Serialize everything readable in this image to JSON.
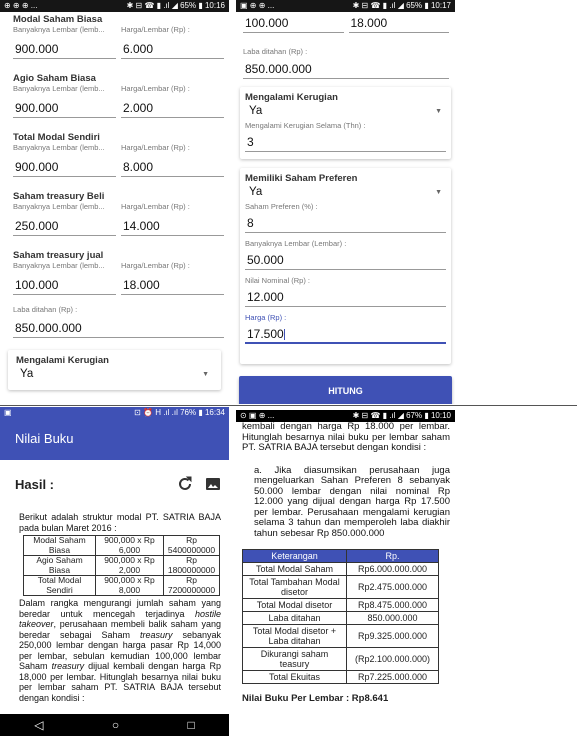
{
  "p1": {
    "status": {
      "left": "⊕ ⊕ ⊕ ...",
      "right": "✱ ⊟ ☎ ▮ .ıl ◢ 65% ▮ 10:16"
    },
    "groups": [
      {
        "title": "Modal Saham Biasa",
        "cap1": "Banyaknya Lembar (lemb...",
        "cap2": "Harga/Lembar (Rp) :",
        "v1": "900.000",
        "v2": "6.000"
      },
      {
        "title": "Agio Saham Biasa",
        "cap1": "Banyaknya Lembar (lemb...",
        "cap2": "Harga/Lembar (Rp) :",
        "v1": "900.000",
        "v2": "2.000"
      },
      {
        "title": "Total Modal Sendiri",
        "cap1": "Banyaknya Lembar (lemb...",
        "cap2": "Harga/Lembar (Rp) :",
        "v1": "900.000",
        "v2": "8.000"
      },
      {
        "title": "Saham treasury Beli",
        "cap1": "Banyaknya Lembar (lemb...",
        "cap2": "Harga/Lembar (Rp) :",
        "v1": "250.000",
        "v2": "14.000"
      },
      {
        "title": "Saham treasury jual",
        "cap1": "Banyaknya Lembar (lemb...",
        "cap2": "Harga/Lembar (Rp) :",
        "v1": "100.000",
        "v2": "18.000"
      }
    ],
    "laba_label": "Laba ditahan (Rp) :",
    "laba_value": "850.000.000",
    "kerugian_title": "Mengalami Kerugian",
    "kerugian_value": "Ya"
  },
  "p2": {
    "status": {
      "left": "▣ ⊕ ⊕ ...",
      "right": "✱ ⊟ ☎ ▮ .ıl ◢ 65% ▮ 10:17"
    },
    "top_v1": "100.000",
    "top_v2": "18.000",
    "laba_label": "Laba ditahan (Rp) :",
    "laba_value": "850.000.000",
    "kerugian_title": "Mengalami Kerugian",
    "kerugian_value": "Ya",
    "kerugian_thn_label": "Mengalami Kerugian Selama (Thn) :",
    "kerugian_thn_value": "3",
    "preferen_title": "Memiliki Saham Preferen",
    "preferen_value": "Ya",
    "pref_pct_label": "Saham Preferen (%) :",
    "pref_pct_value": "8",
    "lembar_label": "Banyaknya Lembar (Lembar) :",
    "lembar_value": "50.000",
    "nominal_label": "Nilai Nominal (Rp) :",
    "nominal_value": "12.000",
    "harga_label": "Harga (Rp) :",
    "harga_value": "17.500",
    "button": "HITUNG"
  },
  "p3": {
    "status": {
      "left": "▣",
      "right": "⊡ ⏰ H .ıl .ıl 76% ▮ 16:34"
    },
    "appbar_title": "Nilai Buku",
    "hasil": "Hasil :",
    "intro": "Berikut adalah struktur modal PT. SATRIA BAJA pada bulan Maret 2016 :",
    "table": [
      [
        "Modal Saham Biasa",
        "900,000 x Rp 6,000",
        "Rp 5400000000"
      ],
      [
        "Agio Saham Biasa",
        "900,000 x Rp 2,000",
        "Rp 1800000000"
      ],
      [
        "Total Modal Sendiri",
        "900,000 x Rp 8,000",
        "Rp 7200000000"
      ]
    ],
    "para_a": "Dalam rangka mengurangi jumlah saham yang beredar untuk mencegah terjadinya ",
    "para_b": "hostile takeover",
    "para_c": ", perusahaan membeli balik saham yang beredar sebagai Saham ",
    "para_d": "treasury",
    "para_e": " sebanyak 250,000 lembar dengan harga pasar Rp 14,000 per lembar, sebulan kemudian 100,000 lembar Saham ",
    "para_f": "treasury",
    "para_g": " dijual kembali dengan harga Rp 18,000 per lembar. Hitunglah besarnya nilai buku per lembar saham PT. SATRIA BAJA tersebut dengan kondisi :",
    "nav": {
      "back": "◁",
      "home": "○",
      "recent": "□"
    }
  },
  "p4": {
    "status": {
      "left": "⊙ ▣ ⊕ ...",
      "right": "✱ ⊟ ☎ ▮ .ıl ◢ 67% ▮ 10:10"
    },
    "top_text": "kembali dengan harga Rp 18.000 per lembar. Hitunglah besarnya nilai buku per lembar saham PT. SATRIA BAJA tersebut dengan kondisi :",
    "item_a": "a. Jika diasumsikan perusahaan juga mengeluarkan Sahan Preferen 8 sebanyak 50.000 lembar dengan nilai nominal Rp 12.000 yang dijual dengan harga Rp 17.500 per lembar. Perusahaan mengalami kerugian selama 3 tahun dan memperoleh laba diakhir tahun sebesar Rp 850.000.000",
    "headers": [
      "Keterangan",
      "Rp."
    ],
    "rows": [
      [
        "Total Modal Saham",
        "Rp6.000.000.000"
      ],
      [
        "Total Tambahan Modal disetor",
        "Rp2.475.000.000"
      ],
      [
        "Total Modal disetor",
        "Rp8.475.000.000"
      ],
      [
        "Laba ditahan",
        "850.000.000"
      ],
      [
        "Total Modal disetor + Laba ditahan",
        "Rp9.325.000.000"
      ],
      [
        "Dikurangi saham teasury",
        "(Rp2.100.000.000)"
      ],
      [
        "Total Ekuitas",
        "Rp7.225.000.000"
      ]
    ],
    "result": "Nilai Buku Per Lembar : Rp8.641"
  },
  "colors": {
    "primary": "#3f51b5",
    "statusbar_dark": "#161616"
  },
  "icons": {
    "refresh": "refresh-icon",
    "image": "image-icon",
    "dropdown": "dropdown-arrow-icon"
  }
}
